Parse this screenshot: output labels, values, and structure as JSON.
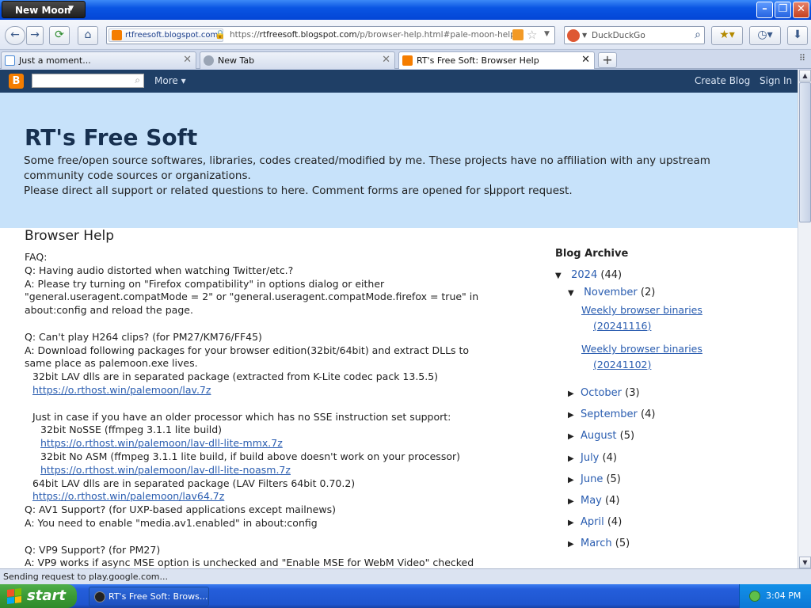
{
  "browser": {
    "app_menu_label": "New Moon",
    "identity_domain": "rtfreesoft.blogspot.com",
    "url_prefix": "https://",
    "url_host": "rtfreesoft.blogspot.com",
    "url_path": "/p/browser-help.html#pale-moon-help",
    "search_engine": "DuckDuckGo",
    "status_text": "Sending request to play.google.com..."
  },
  "tabs": [
    {
      "label": "Just a moment...",
      "icon": "blank-page-icon",
      "active": false
    },
    {
      "label": "New Tab",
      "icon": "globe-icon",
      "active": false
    },
    {
      "label": "RT's Free Soft: Browser Help",
      "icon": "blogger-icon",
      "active": true
    }
  ],
  "bloggerbar": {
    "more_label": "More ▾",
    "create_blog": "Create Blog",
    "sign_in": "Sign In"
  },
  "blog": {
    "title": "RT's Free Soft",
    "description_line1": "Some free/open source softwares, libraries, codes created/modified by me. These projects have no affiliation with any upstream community code sources or organizations.",
    "description_line2": "Please direct all support or related questions to here. Comment forms are opened for support request."
  },
  "post": {
    "title": "Browser Help",
    "lines": [
      {
        "text": "FAQ:",
        "indent": 0,
        "link": false
      },
      {
        "text": "Q: Having audio distorted when watching Twitter/etc.?",
        "indent": 0,
        "link": false
      },
      {
        "text": "A: Please try turning on \"Firefox compatibility\" in options dialog or either",
        "indent": 0,
        "link": false
      },
      {
        "text": "\"general.useragent.compatMode = 2\" or \"general.useragent.compatMode.firefox = true\" in",
        "indent": 0,
        "link": false
      },
      {
        "text": "about:config and reload the page.",
        "indent": 0,
        "link": false
      },
      {
        "text": "",
        "indent": 0,
        "link": false
      },
      {
        "text": "Q: Can't play H264 clips? (for PM27/KM76/FF45)",
        "indent": 0,
        "link": false
      },
      {
        "text": "A: Download following packages for your browser edition(32bit/64bit) and extract DLLs to",
        "indent": 0,
        "link": false
      },
      {
        "text": "same place as palemoon.exe lives.",
        "indent": 0,
        "link": false
      },
      {
        "text": "32bit LAV dlls are in separated package (extracted from K-Lite codec pack 13.5.5)",
        "indent": 1,
        "link": false
      },
      {
        "text": "https://o.rthost.win/palemoon/lav.7z",
        "indent": 1,
        "link": true
      },
      {
        "text": "",
        "indent": 0,
        "link": false
      },
      {
        "text": "Just in case if you have an older processor which has no SSE instruction set support:",
        "indent": 1,
        "link": false
      },
      {
        "text": "32bit NoSSE (ffmpeg 3.1.1 lite build)",
        "indent": 2,
        "link": false
      },
      {
        "text": "https://o.rthost.win/palemoon/lav-dll-lite-mmx.7z",
        "indent": 2,
        "link": true
      },
      {
        "text": "32bit No ASM (ffmpeg 3.1.1 lite build, if build above doesn't work on your processor)",
        "indent": 2,
        "link": false
      },
      {
        "text": "https://o.rthost.win/palemoon/lav-dll-lite-noasm.7z",
        "indent": 2,
        "link": true
      },
      {
        "text": "64bit LAV dlls are in separated package (LAV Filters 64bit 0.70.2)",
        "indent": 1,
        "link": false
      },
      {
        "text": "https://o.rthost.win/palemoon/lav64.7z",
        "indent": 1,
        "link": true
      },
      {
        "text": "Q:  AV1 Support? (for UXP-based applications except mailnews)",
        "indent": 0,
        "link": false
      },
      {
        "text": "A: You need to enable \"media.av1.enabled\" in about:config",
        "indent": 0,
        "link": false
      },
      {
        "text": "",
        "indent": 0,
        "link": false
      },
      {
        "text": "Q:  VP9 Support? (for PM27)",
        "indent": 0,
        "link": false
      },
      {
        "text": "A: VP9 works if async MSE option is unchecked and \"Enable MSE for WebM Video\" checked",
        "indent": 0,
        "link": false
      }
    ]
  },
  "sidebar": {
    "heading": "Blog Archive",
    "year": {
      "label": "2024",
      "count": "(44)",
      "triangle": "▼"
    },
    "month_open": {
      "label": "November",
      "count": "(2)",
      "triangle": "▼"
    },
    "posts": [
      {
        "line1": "Weekly browser binaries",
        "line2": "(20241116)"
      },
      {
        "line1": "Weekly browser binaries",
        "line2": "(20241102)"
      }
    ],
    "months": [
      {
        "label": "October",
        "count": "(3)"
      },
      {
        "label": "September",
        "count": "(4)"
      },
      {
        "label": "August",
        "count": "(5)"
      },
      {
        "label": "July",
        "count": "(4)"
      },
      {
        "label": "June",
        "count": "(5)"
      },
      {
        "label": "May",
        "count": "(4)"
      },
      {
        "label": "April",
        "count": "(4)"
      },
      {
        "label": "March",
        "count": "(5)"
      }
    ]
  },
  "taskbar": {
    "start_label": "start",
    "task_label": "RT's Free Soft: Brows...",
    "clock": "3:04 PM"
  },
  "colors": {
    "header_bg": "#c7e2fa",
    "bloggerbar_bg": "#1f3f66",
    "link": "#2a5db0",
    "blogger_orange": "#f57d00"
  }
}
